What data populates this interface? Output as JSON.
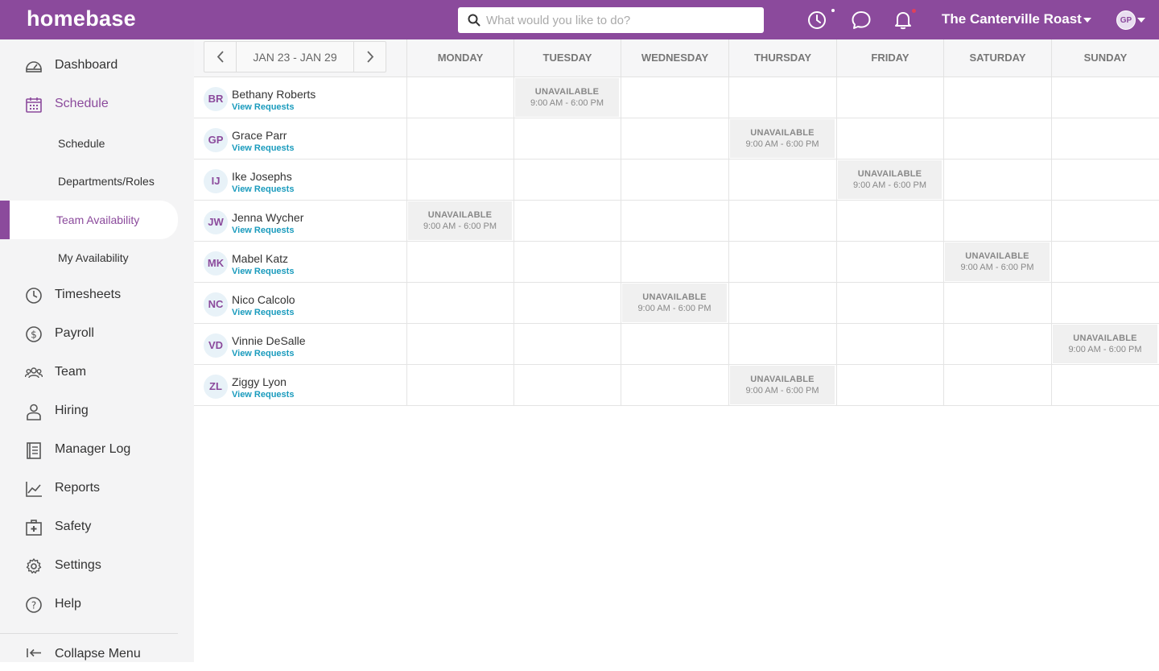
{
  "app": {
    "logo": "homebase",
    "search_placeholder": "What would you like to do?",
    "org_name": "The Canterville Roast",
    "user_initials": "GP"
  },
  "sidebar": {
    "items": [
      {
        "label": "Dashboard",
        "icon": "dashboard-icon"
      },
      {
        "label": "Schedule",
        "icon": "calendar-icon",
        "active": true
      },
      {
        "label": "Timesheets",
        "icon": "clock-icon"
      },
      {
        "label": "Payroll",
        "icon": "dollar-icon"
      },
      {
        "label": "Team",
        "icon": "team-icon"
      },
      {
        "label": "Hiring",
        "icon": "person-icon"
      },
      {
        "label": "Manager Log",
        "icon": "logbook-icon"
      },
      {
        "label": "Reports",
        "icon": "chart-icon"
      },
      {
        "label": "Safety",
        "icon": "first-aid-icon"
      },
      {
        "label": "Settings",
        "icon": "gear-icon"
      },
      {
        "label": "Help",
        "icon": "help-icon"
      }
    ],
    "sub_items": [
      "Schedule",
      "Departments/Roles",
      "Team Availability",
      "My Availability"
    ],
    "collapse_label": "Collapse Menu"
  },
  "week": {
    "range": "JAN 23 - JAN 29"
  },
  "days": [
    "MONDAY",
    "TUESDAY",
    "WEDNESDAY",
    "THURSDAY",
    "FRIDAY",
    "SATURDAY",
    "SUNDAY"
  ],
  "view_requests_label": "View Requests",
  "unavailable": {
    "label": "UNAVAILABLE",
    "time": "9:00 AM - 6:00 PM"
  },
  "employees": [
    {
      "initials": "BR",
      "name": "Bethany Roberts",
      "unavailable_day": 1
    },
    {
      "initials": "GP",
      "name": "Grace Parr",
      "unavailable_day": 3
    },
    {
      "initials": "IJ",
      "name": "Ike Josephs",
      "unavailable_day": 4
    },
    {
      "initials": "JW",
      "name": "Jenna Wycher",
      "unavailable_day": 0
    },
    {
      "initials": "MK",
      "name": "Mabel Katz",
      "unavailable_day": 5
    },
    {
      "initials": "NC",
      "name": "Nico Calcolo",
      "unavailable_day": 2
    },
    {
      "initials": "VD",
      "name": "Vinnie DeSalle",
      "unavailable_day": 6
    },
    {
      "initials": "ZL",
      "name": "Ziggy Lyon",
      "unavailable_day": 3
    }
  ],
  "colors": {
    "brand": "#8b4a9c",
    "link": "#1a9bbd",
    "notification_dot": "#e0405a"
  }
}
